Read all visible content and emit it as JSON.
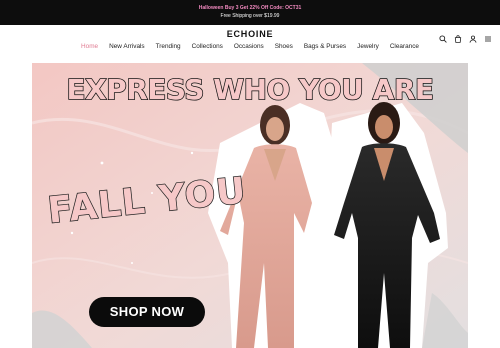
{
  "announcement": {
    "promo": "Halloween Buy 3 Get 22% Off Code: OCT31",
    "shipping": "Free Shipping over $19.99"
  },
  "brand": {
    "logo": "ECHOINE"
  },
  "header_icons": [
    "search-icon",
    "bag-icon",
    "account-icon",
    "menu-icon"
  ],
  "nav": {
    "items": [
      "Home",
      "New Arrivals",
      "Trending",
      "Collections",
      "Occasions",
      "Shoes",
      "Bags & Purses",
      "Jewelry",
      "Clearance"
    ],
    "active": "Home"
  },
  "hero": {
    "headline": "EXPRESS WHO YOU ARE",
    "subheadline": "FALL YOU",
    "cta": "SHOP NOW"
  },
  "colors": {
    "announcement_bg": "#0d0d0d",
    "promo_text": "#f28ac0",
    "nav_active": "#e07b92",
    "hero_bg": "#f0d6d3",
    "cta_bg": "#0b0b0b"
  }
}
